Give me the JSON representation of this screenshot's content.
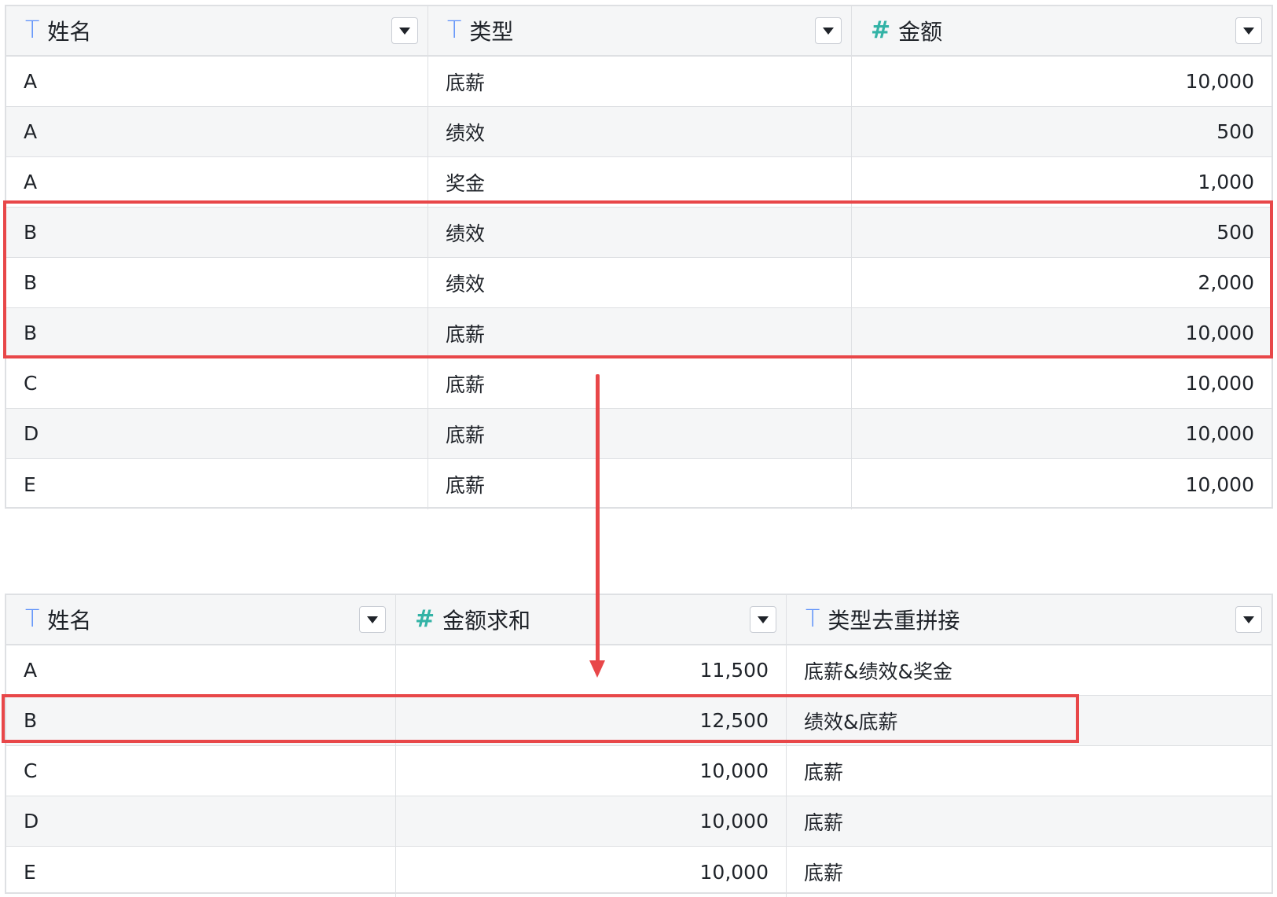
{
  "source_table": {
    "columns": [
      {
        "type_icon": "T",
        "label": "姓名"
      },
      {
        "type_icon": "T",
        "label": "类型"
      },
      {
        "type_icon": "#",
        "label": "金额"
      }
    ],
    "rows": [
      {
        "name": "A",
        "type": "底薪",
        "amount": "10,000"
      },
      {
        "name": "A",
        "type": "绩效",
        "amount": "500"
      },
      {
        "name": "A",
        "type": "奖金",
        "amount": "1,000"
      },
      {
        "name": "B",
        "type": "绩效",
        "amount": "500"
      },
      {
        "name": "B",
        "type": "绩效",
        "amount": "2,000"
      },
      {
        "name": "B",
        "type": "底薪",
        "amount": "10,000"
      },
      {
        "name": "C",
        "type": "底薪",
        "amount": "10,000"
      },
      {
        "name": "D",
        "type": "底薪",
        "amount": "10,000"
      },
      {
        "name": "E",
        "type": "底薪",
        "amount": "10,000"
      }
    ]
  },
  "result_table": {
    "columns": [
      {
        "type_icon": "T",
        "label": "姓名"
      },
      {
        "type_icon": "#",
        "label": "金额求和"
      },
      {
        "type_icon": "T",
        "label": "类型去重拼接"
      }
    ],
    "rows": [
      {
        "name": "A",
        "sum": "11,500",
        "types": "底薪&绩效&奖金"
      },
      {
        "name": "B",
        "sum": "12,500",
        "types": "绩效&底薪"
      },
      {
        "name": "C",
        "sum": "10,000",
        "types": "底薪"
      },
      {
        "name": "D",
        "sum": "10,000",
        "types": "底薪"
      },
      {
        "name": "E",
        "sum": "10,000",
        "types": "底薪"
      }
    ]
  },
  "colors": {
    "highlight": "#e84749",
    "text_type_icon": "#5b8ff9",
    "number_type_icon": "#33b3a6",
    "grid": "#dee0e3",
    "alt_row": "#f5f6f7"
  }
}
